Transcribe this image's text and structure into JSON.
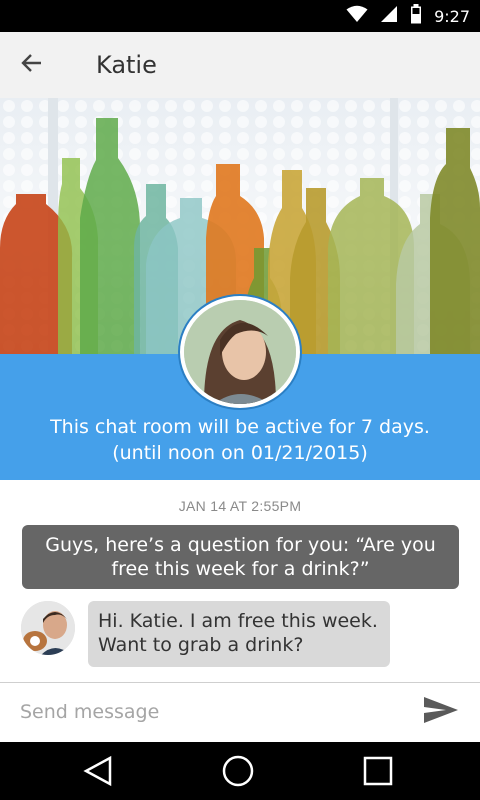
{
  "status_bar": {
    "time": "9:27",
    "icons": [
      "wifi-icon",
      "signal-icon",
      "battery-icon"
    ]
  },
  "app_bar": {
    "title": "Katie",
    "back_icon": "arrow-left-icon"
  },
  "banner": {
    "image": "glass-bottles-photo",
    "avatar": "profile-photo-katie"
  },
  "info": {
    "line1": "This chat room will be active for 7 days.",
    "line2": "(until noon on 01/21/2015)"
  },
  "chat": {
    "timestamp": "JAN 14 AT 2:55PM",
    "messages": [
      {
        "direction": "outgoing",
        "lines": [
          "Guys, here’s a question for you: “Are you",
          "free this week for a drink?”"
        ]
      },
      {
        "direction": "incoming",
        "avatar": "user-photo-with-dog",
        "lines": [
          "Hi. Katie. I am free this week.",
          "Want to grab a drink?"
        ]
      }
    ]
  },
  "composer": {
    "placeholder": "Send message",
    "value": "",
    "send_icon": "send-icon"
  },
  "nav_bar": {
    "icons": [
      "back-triangle-icon",
      "home-circle-icon",
      "recents-square-icon"
    ]
  },
  "colors": {
    "accent": "#45a0ea",
    "outgoing_bubble": "#666666",
    "incoming_bubble": "#d9d9d9",
    "app_bar": "#f2f2f2"
  }
}
